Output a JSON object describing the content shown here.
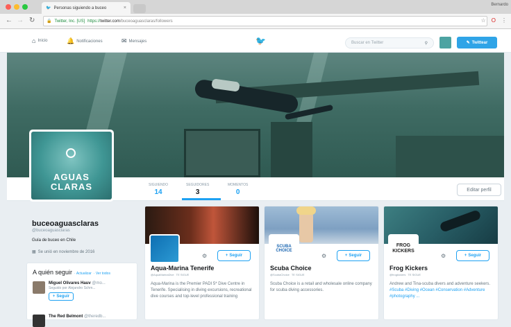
{
  "browser": {
    "tab_title": "Personas siguiendo a buceo",
    "profile_label": "Bernardo",
    "secure_label": "Twitter, Inc. [US]",
    "url_scheme": "https://",
    "url_host": "twitter.com",
    "url_path": "/buceoaguasclaras/followers"
  },
  "nav": {
    "home": "Inicio",
    "notifications": "Notificaciones",
    "messages": "Mensajes",
    "search_placeholder": "Buscar en Twitter",
    "tweet_button": "Twittear"
  },
  "profile": {
    "avatar_line1": "AGUAS",
    "avatar_line2": "CLARAS",
    "name": "buceoaguasclaras",
    "handle": "@buceoaguasclaras",
    "bio": "Guía de buceo en Chile",
    "joined": "Se unió en noviembre de 2016",
    "edit_button": "Editar perfil"
  },
  "stats": [
    {
      "label": "SIGUIENDO",
      "value": "14"
    },
    {
      "label": "SEGUIDORES",
      "value": "3"
    },
    {
      "label": "MOMENTOS",
      "value": "0"
    }
  ],
  "who_to_follow": {
    "title": "A quién seguir",
    "refresh": "· Actualizar",
    "view_all": "· Ver todos",
    "suggestions": [
      {
        "name": "Miguel Olivares Hauv",
        "handle": "@mo...",
        "followed_by": "Seguido por Alejandro Schm...",
        "button": "Seguir"
      },
      {
        "name": "The Red Belmont",
        "handle": "@theredb...",
        "followed_by": "",
        "button": ""
      }
    ]
  },
  "cards": [
    {
      "name": "Aqua-Marina Tenerife",
      "handle": "@AquaMarinaDive",
      "follows_you": "TE SIGUE",
      "button": "Seguir",
      "bio": "Aqua-Marina is the Premier PADI 5* Dive Centre in Tenerife. Specialising in diving excursions, recreational dive courses and top-level professional training",
      "tags": "",
      "avatar_text": ""
    },
    {
      "name": "Scuba Choice",
      "handle": "@ScubaChoice",
      "follows_you": "TE SIGUE",
      "button": "Seguir",
      "bio": "Scuba Choice is a retail and wholesale online company for scuba diving accessories.",
      "tags": "",
      "avatar_text": "SCUBA CHOICE"
    },
    {
      "name": "Frog Kickers",
      "handle": "@frogkickers",
      "follows_you": "TE SIGUE",
      "button": "Seguir",
      "bio": "Andrew and Tina-scuba divers and adventure seekers.",
      "tags": "#Scuba #Diving #Ocean #Conservation #Adventure #photography ...",
      "avatar_text": "FROG KICKERS"
    }
  ],
  "colors": {
    "accent": "#1da1f2",
    "tweet_button": "#2fa4e7",
    "avatar_teal": "#3f9694"
  },
  "icons": [
    "home-icon",
    "bell-icon",
    "mail-icon",
    "twitter-bird-icon",
    "search-icon",
    "person-plus-icon",
    "gear-icon",
    "calendar-icon",
    "quill-icon"
  ]
}
